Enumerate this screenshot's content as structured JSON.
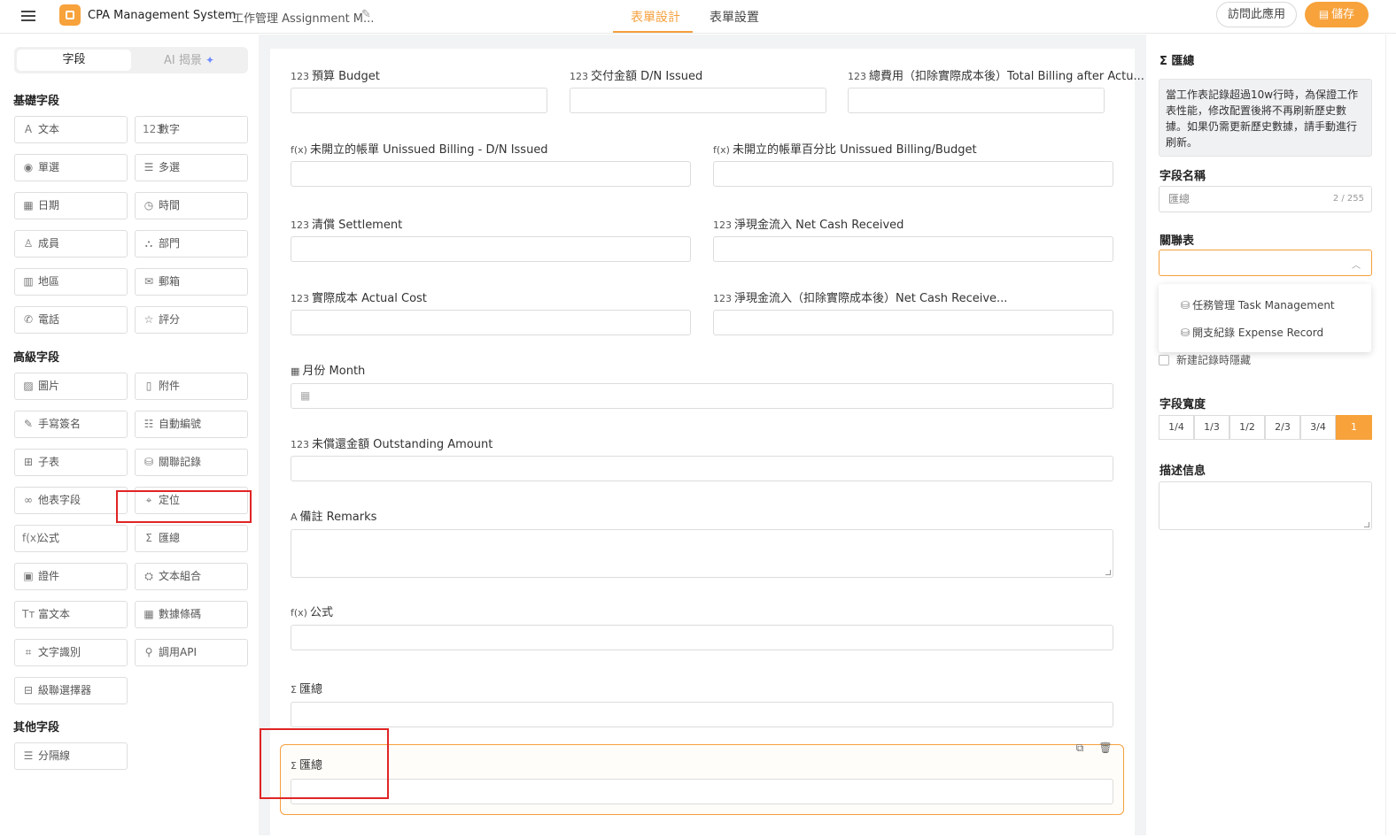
{
  "topbar": {
    "app_name": "CPA Management System",
    "breadcrumb_sep": "›",
    "form_name": "工作管理 Assignment M...",
    "tabs": [
      "表單設計",
      "表單設置"
    ],
    "visit_label": "訪問此應用",
    "save_label": "儲存"
  },
  "left": {
    "seg_fields": "字段",
    "seg_ai": "AI 揭景",
    "basic_title": "基礎字段",
    "advanced_title": "高級字段",
    "other_title": "其他字段",
    "basic": [
      {
        "icon": "A",
        "label": "文本"
      },
      {
        "icon": "123",
        "label": "數字"
      },
      {
        "icon": "◉",
        "label": "單選"
      },
      {
        "icon": "☰",
        "label": "多選"
      },
      {
        "icon": "▦",
        "label": "日期"
      },
      {
        "icon": "◷",
        "label": "時間"
      },
      {
        "icon": "♙",
        "label": "成員"
      },
      {
        "icon": "⛬",
        "label": "部門"
      },
      {
        "icon": "▥",
        "label": "地區"
      },
      {
        "icon": "✉",
        "label": "郵箱"
      },
      {
        "icon": "✆",
        "label": "電話"
      },
      {
        "icon": "☆",
        "label": "評分"
      }
    ],
    "advanced": [
      {
        "icon": "▨",
        "label": "圖片"
      },
      {
        "icon": "▯",
        "label": "附件"
      },
      {
        "icon": "✎",
        "label": "手寫簽名"
      },
      {
        "icon": "☷",
        "label": "自動編號"
      },
      {
        "icon": "⊞",
        "label": "子表"
      },
      {
        "icon": "⛁",
        "label": "關聯記錄"
      },
      {
        "icon": "∞",
        "label": "他表字段"
      },
      {
        "icon": "⌖",
        "label": "定位"
      },
      {
        "icon": "f(x)",
        "label": "公式"
      },
      {
        "icon": "Σ",
        "label": "匯總"
      },
      {
        "icon": "▣",
        "label": "證件"
      },
      {
        "icon": "⛭",
        "label": "文本組合"
      },
      {
        "icon": "Tт",
        "label": "富文本"
      },
      {
        "icon": "▦",
        "label": "數據條碼"
      },
      {
        "icon": "⌗",
        "label": "文字識別"
      },
      {
        "icon": "⚲",
        "label": "調用API"
      },
      {
        "icon": "⊟",
        "label": "級聯選擇器"
      }
    ],
    "other": [
      {
        "icon": "☰",
        "label": "分隔線"
      }
    ]
  },
  "canvas": {
    "fields": [
      {
        "icon": "123",
        "label": "預算 Budget"
      },
      {
        "icon": "123",
        "label": "交付金額 D/N Issued"
      },
      {
        "icon": "123",
        "label": "總費用（扣除實際成本後）Total Billing after Actu..."
      },
      {
        "icon": "f(x)",
        "label": "未開立的帳單 Unissued Billing - D/N Issued"
      },
      {
        "icon": "f(x)",
        "label": "未開立的帳單百分比 Unissued Billing/Budget"
      },
      {
        "icon": "123",
        "label": "清償 Settlement"
      },
      {
        "icon": "123",
        "label": "淨現金流入 Net Cash Received"
      },
      {
        "icon": "123",
        "label": "實際成本 Actual Cost"
      },
      {
        "icon": "123",
        "label": "淨現金流入（扣除實際成本後）Net Cash Receive..."
      },
      {
        "icon": "▦",
        "label": "月份 Month"
      },
      {
        "icon": "123",
        "label": "未償還金額 Outstanding Amount"
      },
      {
        "icon": "A",
        "label": "備註 Remarks"
      },
      {
        "icon": "f(x)",
        "label": "公式"
      },
      {
        "icon": "Σ",
        "label": "匯總"
      },
      {
        "icon": "Σ",
        "label": "匯總"
      }
    ]
  },
  "right": {
    "title": "匯總",
    "notice": "當工作表記錄超過10w行時，為保證工作表性能，修改配置後將不再刷新歷史數據。如果仍需更新歷史數據，請手動進行刷新。",
    "field_name_label": "字段名稱",
    "field_name_value": "匯總",
    "field_name_count": "2 / 255",
    "linked_table_label": "關聯表",
    "dropdown_options": [
      "任務管理 Task Management",
      "開支紀錄 Expense Record"
    ],
    "hide_on_new_label": "新建記錄時隱藏",
    "width_label": "字段寬度",
    "width_options": [
      "1/4",
      "1/3",
      "1/2",
      "2/3",
      "3/4",
      "1"
    ],
    "width_selected": "1",
    "description_label": "描述信息"
  },
  "colors": {
    "accent": "#f7a23b",
    "highlight": "#e02424"
  }
}
